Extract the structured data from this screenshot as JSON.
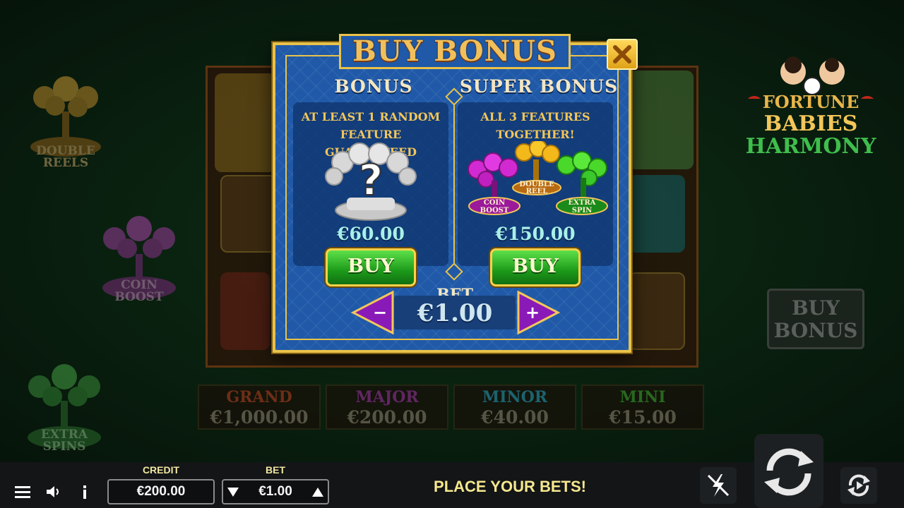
{
  "background": {
    "features": [
      {
        "label_line1": "DOUBLE",
        "label_line2": "REELS",
        "color": "gold"
      },
      {
        "label_line1": "COIN",
        "label_line2": "BOOST",
        "color": "pink"
      },
      {
        "label_line1": "EXTRA",
        "label_line2": "SPINS",
        "color": "green"
      }
    ],
    "logo": {
      "line1": "FORTUNE",
      "line2": "BABIES",
      "line3": "HARMONY"
    },
    "buy_bonus_button": {
      "line1": "BUY",
      "line2": "BONUS"
    },
    "jackpots": [
      {
        "name": "GRAND",
        "value": "€1,000.00",
        "color": "#b0391c"
      },
      {
        "name": "MAJOR",
        "value": "€200.00",
        "color": "#9a2a9a"
      },
      {
        "name": "MINOR",
        "value": "€40.00",
        "color": "#2a8fb0"
      },
      {
        "name": "MINI",
        "value": "€15.00",
        "color": "#3c9a2a"
      }
    ]
  },
  "modal": {
    "title": "BUY BONUS",
    "close_icon": "close-x-icon",
    "bonus": {
      "heading": "BONUS",
      "description_line1": "AT LEAST 1 RANDOM",
      "description_line2": "FEATURE GUARANTEED",
      "question_mark": "?",
      "price": "€60.00",
      "buy_label": "BUY"
    },
    "super_bonus": {
      "heading": "SUPER BONUS",
      "description_line1": "ALL 3 FEATURES",
      "description_line2": "TOGETHER!",
      "tree_labels": {
        "coin": [
          "COIN",
          "BOOST"
        ],
        "double": [
          "DOUBLE",
          "REEL"
        ],
        "extra": [
          "EXTRA",
          "SPIN"
        ]
      },
      "price": "€150.00",
      "buy_label": "BUY"
    },
    "bet": {
      "label": "BET",
      "value": "€1.00",
      "decrease_symbol": "−",
      "increase_symbol": "+"
    }
  },
  "bottom_bar": {
    "credit_label": "CREDIT",
    "credit_value": "€200.00",
    "bet_label": "BET",
    "bet_value": "€1.00",
    "status": "PLACE YOUR BETS!",
    "icons": [
      "menu-icon",
      "sound-icon",
      "info-icon",
      "turbo-icon",
      "spin-icon",
      "autoplay-icon"
    ]
  },
  "colors": {
    "accent_gold": "#e9c24a",
    "modal_blue": "#1f59a8",
    "buy_green": "#1c9a1a",
    "status_yellow": "#f5e88e"
  }
}
